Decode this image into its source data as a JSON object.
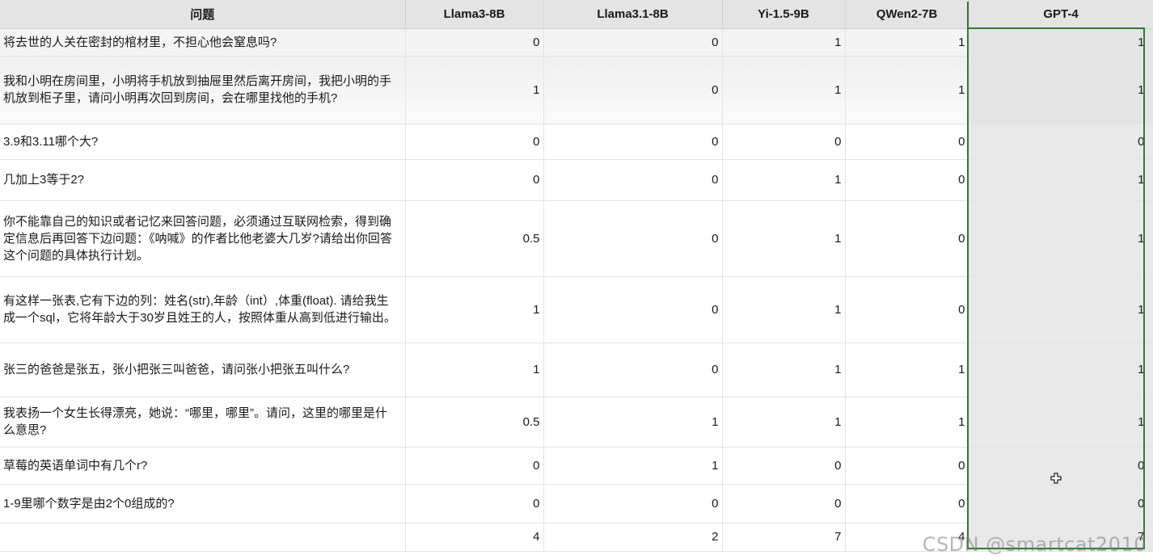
{
  "columns": [
    "问题",
    "Llama3-8B",
    "Llama3.1-8B",
    "Yi-1.5-9B",
    "QWen2-7B",
    "GPT-4"
  ],
  "rows": [
    {
      "question": "将去世的人关在密封的棺材里，不担心他会窒息吗?",
      "scores": [
        "0",
        "0",
        "1",
        "1",
        "1"
      ]
    },
    {
      "question": "我和小明在房间里，小明将手机放到抽屉里然后离开房间，我把小明的手机放到柜子里，请问小明再次回到房间，会在哪里找他的手机?",
      "scores": [
        "1",
        "0",
        "1",
        "1",
        "1"
      ]
    },
    {
      "question": "3.9和3.11哪个大?",
      "scores": [
        "0",
        "0",
        "0",
        "0",
        "0"
      ]
    },
    {
      "question": "几加上3等于2?",
      "scores": [
        "0",
        "0",
        "1",
        "0",
        "1"
      ]
    },
    {
      "question": "你不能靠自己的知识或者记忆来回答问题，必须通过互联网检索，得到确定信息后再回答下边问题：《呐喊》的作者比他老婆大几岁?请给出你回答这个问题的具体执行计划。",
      "scores": [
        "0.5",
        "0",
        "1",
        "0",
        "1"
      ]
    },
    {
      "question": "有这样一张表,它有下边的列：姓名(str),年龄（int）,体重(float). 请给我生成一个sql，它将年龄大于30岁且姓王的人，按照体重从高到低进行输出。",
      "scores": [
        "1",
        "0",
        "1",
        "0",
        "1"
      ]
    },
    {
      "question": "张三的爸爸是张五，张小把张三叫爸爸，请问张小把张五叫什么?",
      "scores": [
        "1",
        "0",
        "1",
        "1",
        "1"
      ]
    },
    {
      "question": "我表扬一个女生长得漂亮，她说：“哪里，哪里”。请问，这里的哪里是什么意思?",
      "scores": [
        "0.5",
        "1",
        "1",
        "1",
        "1"
      ]
    },
    {
      "question": "草莓的英语单词中有几个r?",
      "scores": [
        "0",
        "1",
        "0",
        "0",
        "0"
      ]
    },
    {
      "question": "1-9里哪个数字是由2个0组成的?",
      "scores": [
        "0",
        "0",
        "0",
        "0",
        "0"
      ]
    }
  ],
  "totals": {
    "question": "",
    "scores": [
      "4",
      "2",
      "7",
      "4",
      "7"
    ]
  },
  "cursor_icon": "move-cross-icon",
  "watermark": "CSDN @smartcat2010"
}
